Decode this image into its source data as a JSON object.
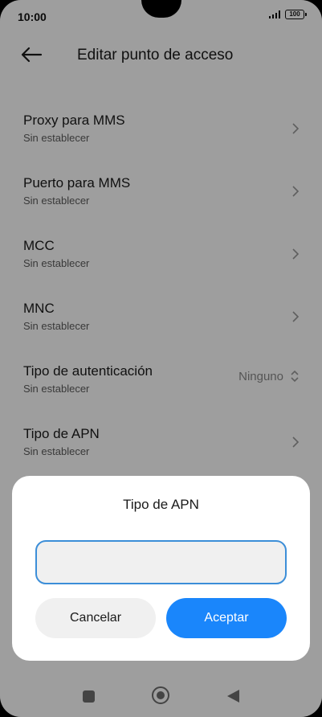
{
  "status_bar": {
    "time": "10:00",
    "battery": "100",
    "icons": [
      "signal-icon",
      "battery-icon"
    ]
  },
  "header": {
    "back_icon": "arrow-left-icon",
    "title": "Editar punto de acceso"
  },
  "settings": [
    {
      "title": "Proxy para MMS",
      "subtitle": "Sin establecer"
    },
    {
      "title": "Puerto para MMS",
      "subtitle": "Sin establecer"
    },
    {
      "title": "MCC",
      "subtitle": "Sin establecer"
    },
    {
      "title": "MNC",
      "subtitle": "Sin establecer"
    },
    {
      "title": "Tipo de autenticación",
      "subtitle": "Sin establecer",
      "value": "Ninguno"
    },
    {
      "title": "Tipo de APN",
      "subtitle": "Sin establecer"
    }
  ],
  "dialog": {
    "title": "Tipo de APN",
    "input_value": "",
    "cancel_label": "Cancelar",
    "accept_label": "Aceptar"
  },
  "colors": {
    "accent": "#1a86fb",
    "input_border": "#3c8ed8",
    "overlay": "rgba(0,0,0,0.38)"
  }
}
